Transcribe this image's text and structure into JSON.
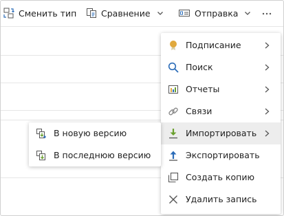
{
  "toolbar": {
    "change_type": {
      "label": "Сменить тип",
      "icon": "change-type-icon"
    },
    "compare": {
      "label": "Сравнение",
      "icon": "compare-icon"
    },
    "send": {
      "label": "Отправка",
      "icon": "send-icon"
    },
    "more": {
      "icon": "more-icon"
    }
  },
  "menu": {
    "items": [
      {
        "label": "Подписание",
        "icon": "medal-icon",
        "has_submenu": true
      },
      {
        "label": "Поиск",
        "icon": "search-icon",
        "has_submenu": true
      },
      {
        "label": "Отчеты",
        "icon": "report-icon",
        "has_submenu": true
      },
      {
        "label": "Связи",
        "icon": "link-icon",
        "has_submenu": true
      },
      {
        "label": "Импортировать",
        "icon": "import-icon",
        "has_submenu": true,
        "active": true
      },
      {
        "label": "Экспортировать",
        "icon": "export-icon",
        "has_submenu": false
      },
      {
        "label": "Создать копию",
        "icon": "copy-icon",
        "has_submenu": false
      },
      {
        "label": "Удалить запись",
        "icon": "delete-icon",
        "has_submenu": false
      }
    ]
  },
  "submenu": {
    "items": [
      {
        "label": "В новую версию",
        "icon": "new-version-icon"
      },
      {
        "label": "В последнюю версию",
        "icon": "latest-version-icon"
      }
    ]
  },
  "colors": {
    "accent_blue": "#2b6cb8",
    "import_green": "#6aa02e",
    "medal_gold": "#e1a93d",
    "hover_bg": "#ededed"
  }
}
